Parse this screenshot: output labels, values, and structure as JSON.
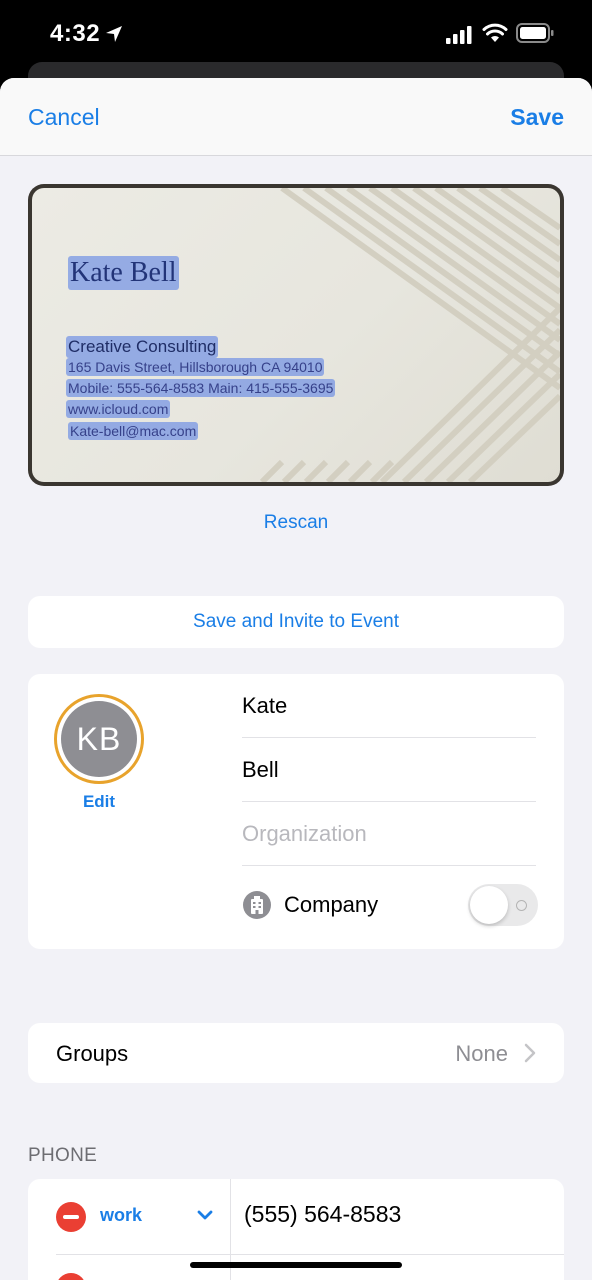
{
  "status_bar": {
    "time": "4:32",
    "icons": [
      "location-arrow-icon",
      "signal-icon",
      "wifi-icon",
      "battery-icon"
    ]
  },
  "nav": {
    "cancel_label": "Cancel",
    "save_label": "Save"
  },
  "business_card": {
    "name": "Kate Bell",
    "company": "Creative Consulting",
    "address": "165 Davis Street, Hillsborough CA 94010",
    "phones": "Mobile: 555-564-8583 Main: 415-555-3695",
    "website": "www.icloud.com",
    "email": "Kate-bell@mac.com"
  },
  "rescan_label": "Rescan",
  "invite_label": "Save and Invite to Event",
  "contact": {
    "initials": "KB",
    "edit_label": "Edit",
    "first_name": "Kate",
    "last_name": "Bell",
    "organization_placeholder": "Organization",
    "company_label": "Company",
    "company_toggle_on": false
  },
  "groups": {
    "label": "Groups",
    "value": "None"
  },
  "phone_section": {
    "header": "PHONE",
    "entries": [
      {
        "type": "work",
        "number": "(555) 564-8583"
      }
    ]
  },
  "colors": {
    "accent": "#1a7ee6",
    "delete": "#ea3f33",
    "avatar_ring": "#e8a32c",
    "highlight": "#4e78e6"
  }
}
